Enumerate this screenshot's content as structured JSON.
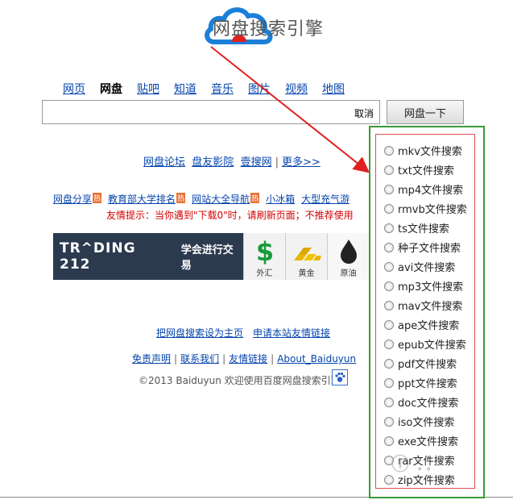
{
  "logo": {
    "text": "网盘搜索引擎"
  },
  "nav": {
    "items": [
      "网页",
      "网盘",
      "贴吧",
      "知道",
      "音乐",
      "图片",
      "视频",
      "地图"
    ],
    "active": "网盘"
  },
  "search": {
    "value": "",
    "clear_label": "取消",
    "button_label": "网盘一下"
  },
  "quick_links": {
    "items": [
      "网盘论坛",
      "盘友影院",
      "壹搜网",
      "更多>>"
    ]
  },
  "hot_links": {
    "items": [
      {
        "label": "网盘分享",
        "badge": "热"
      },
      {
        "label": "教育部大学排名",
        "badge": "热"
      },
      {
        "label": "网站大全导航",
        "badge": "热"
      },
      {
        "label": "小冰箱",
        "badge": ""
      },
      {
        "label": "大型充气游",
        "badge": ""
      }
    ]
  },
  "tip": "友情提示：当你遇到\"下载0\"时，请刷新页面；不推荐使用",
  "banner": {
    "brand": "TR^DING 212",
    "slogan": "学会进行交易",
    "tiles": [
      {
        "cap": "外汇",
        "symbol": "$"
      },
      {
        "cap": "黄金",
        "symbol": ""
      },
      {
        "cap": "原油",
        "symbol": ""
      }
    ]
  },
  "footer": {
    "row1": [
      "把网盘搜索设为主页",
      "申请本站友情链接"
    ],
    "row2": [
      "免责声明",
      "联系我们",
      "友情链接",
      "About_Baiduyun"
    ],
    "copyright": "©2013 Baiduyun 欢迎使用百度网盘搜索引擎"
  },
  "dropdown": {
    "options": [
      "mkv文件搜索",
      "txt文件搜索",
      "mp4文件搜索",
      "rmvb文件搜索",
      "ts文件搜索",
      "种子文件搜索",
      "avi文件搜索",
      "mp3文件搜索",
      "mav文件搜索",
      "ape文件搜索",
      "epub文件搜索",
      "pdf文件搜索",
      "ppt文件搜索",
      "doc文件搜索",
      "iso文件搜索",
      "exe文件搜索",
      "rar文件搜索",
      "zip文件搜索"
    ]
  },
  "colors": {
    "link": "#0645ad",
    "panel_border": "#3a9a3a",
    "inner_border": "#e05050",
    "arrow": "#e02020",
    "tip": "#d20000",
    "logo_blue": "#1a7fd8",
    "logo_red": "#e02020"
  }
}
